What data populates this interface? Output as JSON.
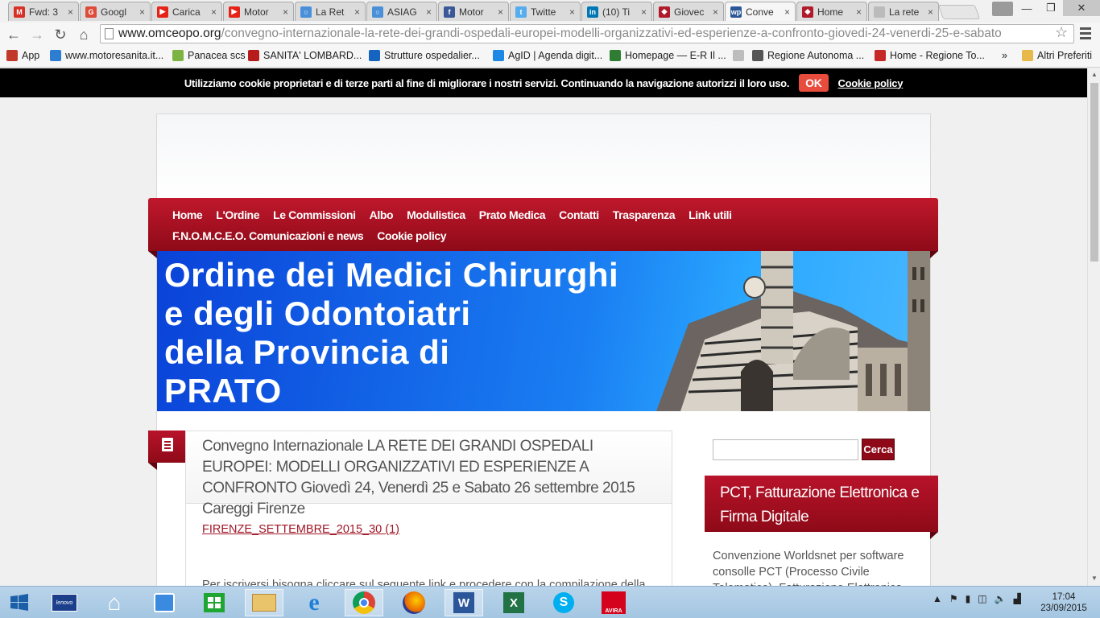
{
  "browser": {
    "tabs": [
      {
        "title": "Fwd: 3",
        "icon": "gmail-icon",
        "color": "#d93025",
        "glyph": "M"
      },
      {
        "title": "Googl",
        "icon": "google-plus-icon",
        "color": "#dd4b39",
        "glyph": "G"
      },
      {
        "title": "Carica",
        "icon": "youtube-icon",
        "color": "#e62117",
        "glyph": "▶"
      },
      {
        "title": "Motor",
        "icon": "youtube-icon",
        "color": "#e62117",
        "glyph": "▶"
      },
      {
        "title": "La Ret",
        "icon": "loading-icon",
        "color": "#4a90d9",
        "glyph": "○"
      },
      {
        "title": "ASIAG",
        "icon": "loading-icon",
        "color": "#4a90d9",
        "glyph": "○"
      },
      {
        "title": "Motor",
        "icon": "facebook-icon",
        "color": "#3b5998",
        "glyph": "f"
      },
      {
        "title": "Twitte",
        "icon": "twitter-icon",
        "color": "#55acee",
        "glyph": "t"
      },
      {
        "title": "(10) Ti",
        "icon": "linkedin-icon",
        "color": "#0077b5",
        "glyph": "in"
      },
      {
        "title": "Giovec",
        "icon": "site-icon",
        "color": "#b01a2a",
        "glyph": "◆"
      },
      {
        "title": "Conve",
        "icon": "wordpress-icon",
        "color": "#2b5797",
        "glyph": "wp"
      },
      {
        "title": "Home",
        "icon": "site-icon",
        "color": "#b01a2a",
        "glyph": "◆"
      },
      {
        "title": "La rete",
        "icon": "page-icon",
        "color": "#bbbbbb",
        "glyph": ""
      }
    ],
    "url_host": "www.omceopo.org",
    "url_path": "/convegno-internazionale-la-rete-dei-grandi-ospedali-europei-modelli-organizzativi-ed-esperienze-a-confronto-giovedi-24-venerdi-25-e-sabato",
    "bookmarks": [
      {
        "label": "App",
        "color": "#c0392b"
      },
      {
        "label": "www.motoresanita.it...",
        "color": "#2d7dd2"
      },
      {
        "label": "Panacea scs",
        "color": "#7cb342"
      },
      {
        "label": "SANITA' LOMBARD...",
        "color": "#b71c1c"
      },
      {
        "label": "Strutture ospedalier...",
        "color": "#1565c0"
      },
      {
        "label": "AgID | Agenda digit...",
        "color": "#1e88e5"
      },
      {
        "label": "Homepage — E-R Il ...",
        "color": "#2e7d32"
      },
      {
        "label": "",
        "color": "#bdbdbd"
      },
      {
        "label": "Regione Autonoma ...",
        "color": "#555555"
      },
      {
        "label": "Home - Regione To...",
        "color": "#c62828"
      }
    ],
    "bookmarks_more": "»",
    "other_bookmarks": "Altri Preferiti"
  },
  "cookie": {
    "text": "Utilizziamo cookie proprietari e di terze parti al fine di migliorare i nostri servizi. Continuando la navigazione autorizzi il loro uso.",
    "ok": "OK",
    "policy": "Cookie policy"
  },
  "nav": {
    "items": [
      "Home",
      "L'Ordine",
      "Le Commissioni",
      "Albo",
      "Modulistica",
      "Prato Medica",
      "Contatti",
      "Trasparenza",
      "Link utili",
      "F.N.O.M.C.E.O. Comunicazioni e news",
      "Cookie policy"
    ]
  },
  "banner": {
    "line1": "Ordine dei Medici Chirurghi",
    "line2": "e degli Odontoiatri",
    "line3": "della Provincia di",
    "line4": "PRATO"
  },
  "post": {
    "title": "Convegno Internazionale LA RETE DEI GRANDI OSPEDALI EUROPEI: MODELLI ORGANIZZATIVI ED ESPERIENZE A CONFRONTO Giovedì 24, Venerdì 25 e Sabato 26 settembre 2015 Careggi Firenze",
    "link": "FIRENZE_SETTEMBRE_2015_30 (1)",
    "body": "Per iscriversi bisogna cliccare sul seguente link e procedere con la compilazione della"
  },
  "sidebar": {
    "search_button": "Cerca",
    "widget_title": "PCT, Fatturazione Elettronica e Firma Digitale",
    "widget_text": "Convenzione Worldsnet per software consolle PCT (Processo Civile Telematico), Fatturazione Elettronica"
  },
  "taskbar": {
    "time": "17:04",
    "date": "23/09/2015"
  },
  "colors": {
    "nav_red": "#a80f22",
    "banner_blue": "#1a7ef2",
    "link_red": "#a01626"
  }
}
